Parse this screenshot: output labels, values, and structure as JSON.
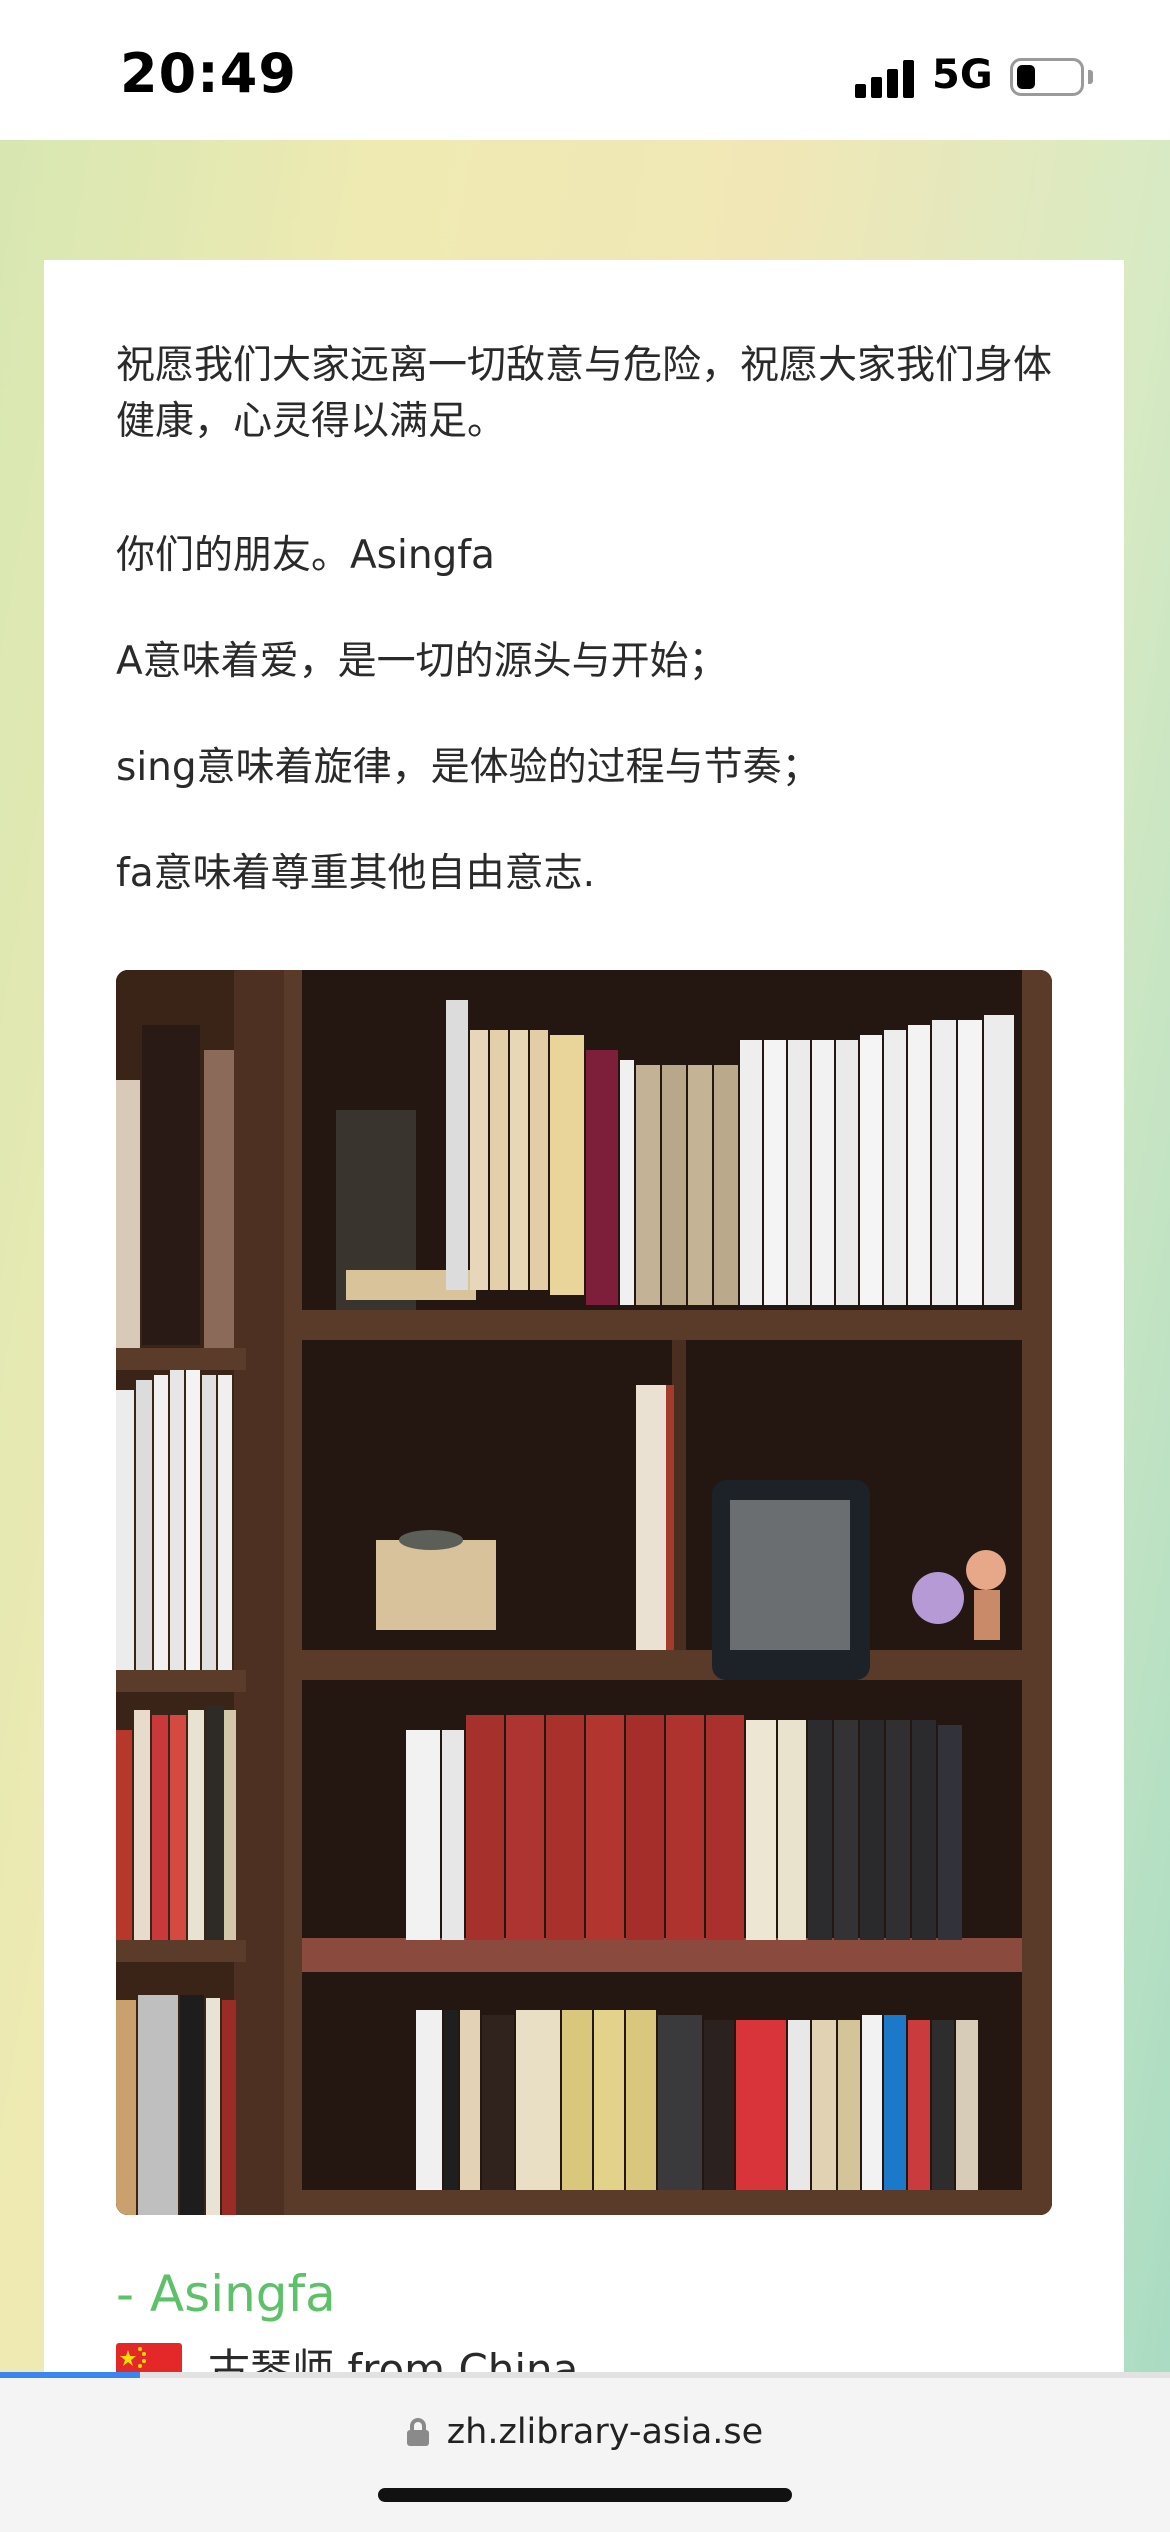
{
  "status": {
    "time": "20:49",
    "network": "5G",
    "battery_level": 0.3
  },
  "article": {
    "paragraphs": [
      "祝愿我们大家远离一切敌意与危险，祝愿大家我们身体健康，心灵得以满足。",
      "你们的朋友。Asingfa",
      "A意味着爱，是一切的源头与开始；",
      "sing意味着旋律，是体验的过程与节奏；",
      "fa意味着尊重其他自由意志."
    ],
    "photo_icon": "bookshelf-photo",
    "signature": "- Asingfa",
    "flag_icon": "china-flag-icon",
    "origin": "古琴师 from China"
  },
  "browser": {
    "url": "zh.zlibrary-asia.se",
    "load_progress": 0.12,
    "lock_icon": "lock-icon"
  },
  "colors": {
    "signature": "#5cc168",
    "progress": "#3a86f0"
  }
}
